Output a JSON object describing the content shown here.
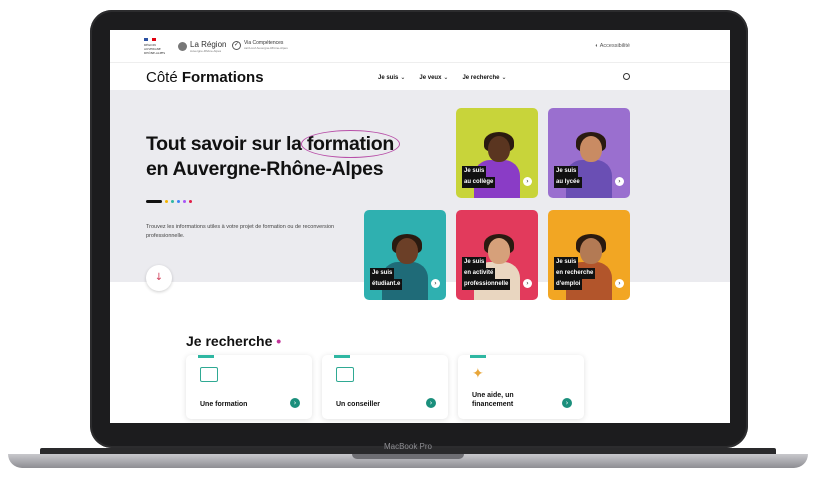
{
  "device": {
    "label": "MacBook Pro"
  },
  "topbar": {
    "gov_lines": "RÉGION AUVERGNE RHÔNE-ALPES",
    "region_name": "La Région",
    "region_sub": "Auvergne-Rhône-Alpes",
    "via_name": "Via Compétences",
    "via_sub": "carif-oref Auvergne-Rhône-Alpes",
    "accessibility": "Accessibilité"
  },
  "navbar": {
    "brand_light": "Côté ",
    "brand_bold": "Formations",
    "items": [
      "Je suis",
      "Je veux",
      "Je recherche"
    ]
  },
  "hero": {
    "title_before": "Tout savoir sur la ",
    "title_highlight": "formation",
    "title_line2": "en Auvergne-Rhône-Alpes",
    "intro": "Trouvez les informations utiles à votre projet de formation ou de reconversion professionnelle.",
    "dot_colors": [
      "#f4b400",
      "#2fb7a2",
      "#3b82f6",
      "#a855f7",
      "#e11d48"
    ]
  },
  "profiles": [
    {
      "line1": "Je suis",
      "line2": "au collège",
      "bg": "#c8d43a",
      "torso": "#8a3cc6",
      "skin": "#5a3520"
    },
    {
      "line1": "Je suis",
      "line2": "au lycée",
      "bg": "#9a6fcf",
      "torso": "#6a4fb4",
      "skin": "#c98b63"
    },
    {
      "line1": "Je suis",
      "line2": "étudiant.e",
      "bg": "#2fb0b0",
      "torso": "#1f6b78",
      "skin": "#6b3f27"
    },
    {
      "line1": "Je suis",
      "line2": "en activité",
      "line3": "professionnelle",
      "bg": "#e23a5c",
      "torso": "#e9d6c0",
      "skin": "#d6a07a"
    },
    {
      "line1": "Je suis",
      "line2": "en recherche",
      "line3": "d'emploi",
      "bg": "#f2a623",
      "torso": "#b2552b",
      "skin": "#b37a54"
    }
  ],
  "search": {
    "title": "Je recherche",
    "cards": [
      {
        "label": "Une formation",
        "icon": "laptop-icon"
      },
      {
        "label": "Un conseiller",
        "icon": "advisor-icon"
      },
      {
        "label_1": "Une aide, un",
        "label_2": "financement",
        "icon": "star-icon"
      }
    ]
  }
}
